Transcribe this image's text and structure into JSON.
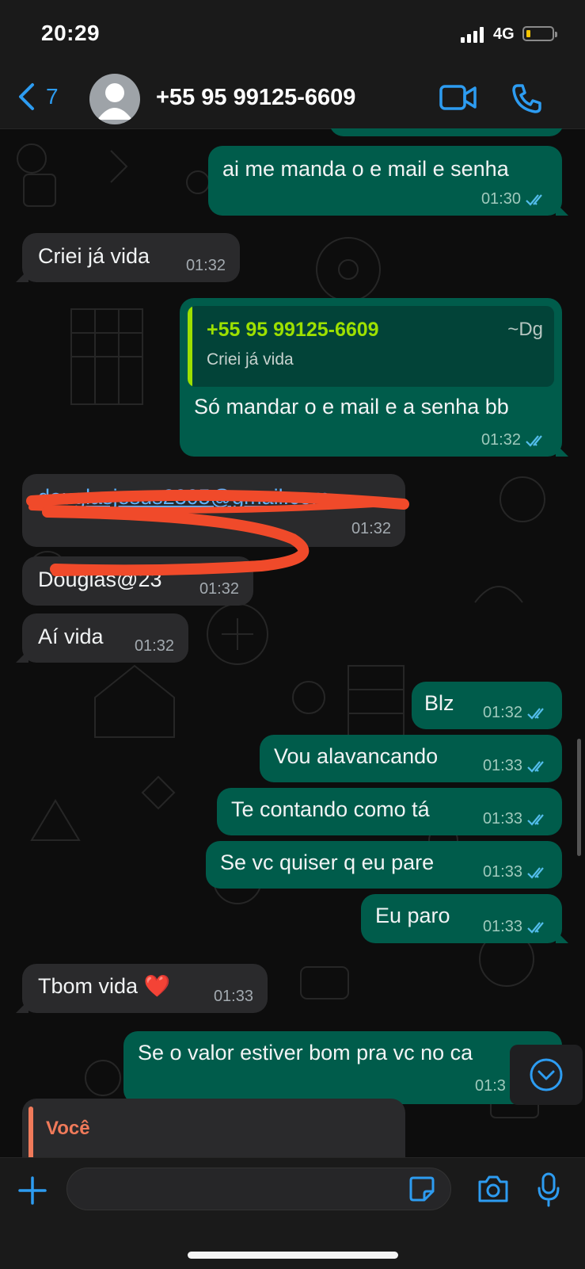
{
  "status_bar": {
    "time": "20:29",
    "network": "4G"
  },
  "header": {
    "back_count": "7",
    "contact_name": "+55 95 99125-6609"
  },
  "messages": [
    {
      "dir": "out",
      "text": "ai me manda o e mail e senha",
      "time": "01:30"
    },
    {
      "dir": "in",
      "text": "Criei já vida",
      "time": "01:32"
    },
    {
      "dir": "out",
      "quote": {
        "name": "+55 95 99125-6609",
        "author": "~Dg",
        "text": "Criei já vida"
      },
      "text": "Só mandar o e mail e a senha bb",
      "time": "01:32"
    },
    {
      "dir": "in",
      "text": "douglasjesus2305@gmail.com",
      "time": "01:32",
      "redacted": true
    },
    {
      "dir": "in",
      "text": "Douglas@23",
      "time": "01:32",
      "redacted": true
    },
    {
      "dir": "in",
      "text": "Aí vida",
      "time": "01:32"
    },
    {
      "dir": "out",
      "text": "Blz",
      "time": "01:32"
    },
    {
      "dir": "out",
      "text": "Vou alavancando",
      "time": "01:33"
    },
    {
      "dir": "out",
      "text": "Te contando como tá",
      "time": "01:33"
    },
    {
      "dir": "out",
      "text": "Se vc quiser q eu pare",
      "time": "01:33"
    },
    {
      "dir": "out",
      "text": "Eu paro",
      "time": "01:33"
    },
    {
      "dir": "in",
      "text": "Tbom vida ❤️",
      "time": "01:33"
    },
    {
      "dir": "out",
      "text": "Se o valor estiver bom pra vc no ca",
      "time": "01:3"
    },
    {
      "dir": "in",
      "quote_name": "Você"
    }
  ],
  "colors": {
    "outgoing": "#005c4b",
    "incoming": "#2a2a2c",
    "accent": "#2d9cf1",
    "quote_bar": "#9de000",
    "redaction": "#f04a2a"
  },
  "icons": [
    "chevron-left-icon",
    "avatar-icon",
    "video-call-icon",
    "phone-icon",
    "plus-icon",
    "sticker-icon",
    "camera-icon",
    "microphone-icon",
    "chevron-down-icon",
    "double-check-icon"
  ]
}
